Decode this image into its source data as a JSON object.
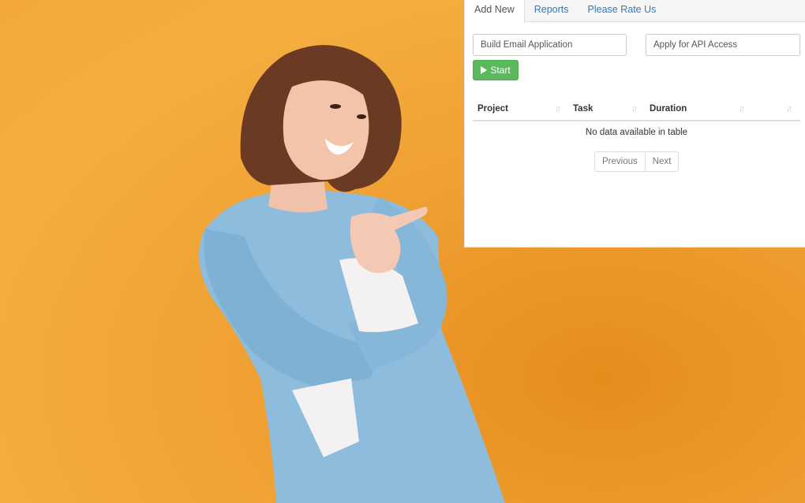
{
  "tabs": [
    {
      "label": "Add New",
      "active": true
    },
    {
      "label": "Reports",
      "active": false
    },
    {
      "label": "Please Rate Us",
      "active": false
    }
  ],
  "form": {
    "project_placeholder": "Build Email Application",
    "task_placeholder": "Apply for API Access",
    "start_label": "Start"
  },
  "table": {
    "columns": [
      "Project",
      "Task",
      "Duration",
      ""
    ],
    "empty_message": "No data available in table"
  },
  "pagination": {
    "previous_label": "Previous",
    "next_label": "Next"
  },
  "colors": {
    "background": "#f2a93a",
    "start_button": "#5cb85c",
    "tab_link": "#337ab7",
    "dress": "#8dbcdc"
  },
  "icons": [
    "play-icon",
    "sort-icon"
  ]
}
